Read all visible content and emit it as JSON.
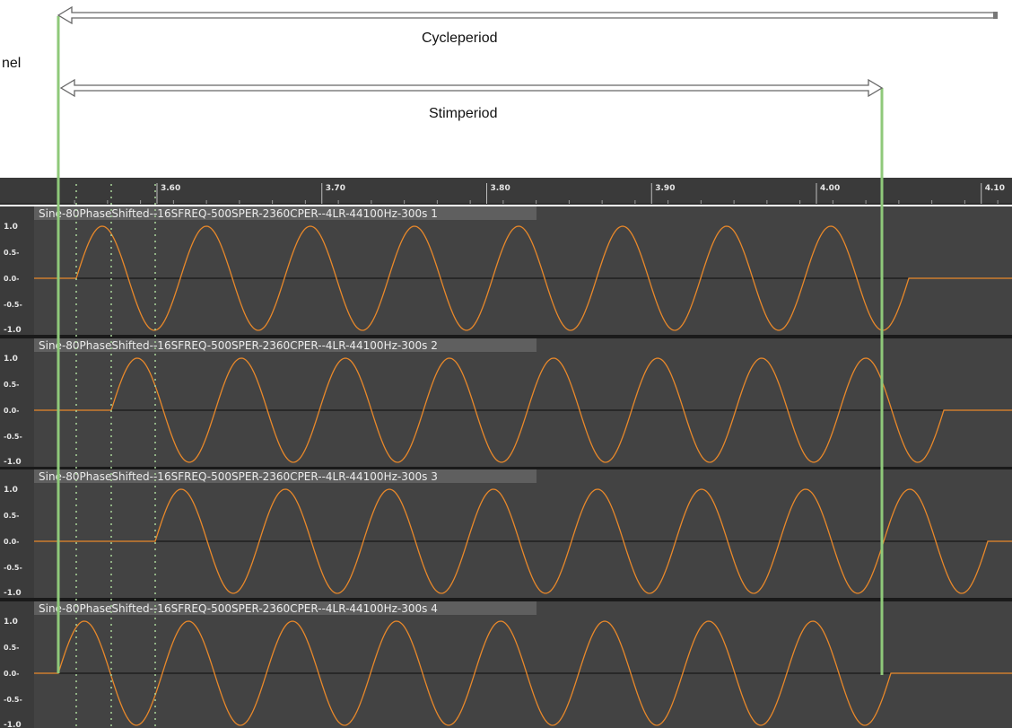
{
  "annotations": {
    "side_text": "nel",
    "cycle_label": "Cycleperiod",
    "stim_label": "Stimperiod"
  },
  "ruler": {
    "ticks": [
      "3.60",
      "3.70",
      "3.80",
      "3.90",
      "4.00",
      "4.10"
    ]
  },
  "tracks": [
    {
      "name": "Sine-80PhaseShifted--16SFREQ-500SPER-2360CPER--4LR-44100Hz-300s 1",
      "amp_labels": [
        "1.0",
        "0.5-",
        "0.0-",
        "-0.5-",
        "-1.0"
      ]
    },
    {
      "name": "Sine-80PhaseShifted--16SFREQ-500SPER-2360CPER--4LR-44100Hz-300s 2",
      "amp_labels": [
        "1.0",
        "0.5-",
        "0.0-",
        "-0.5-",
        "-1.0"
      ]
    },
    {
      "name": "Sine-80PhaseShifted--16SFREQ-500SPER-2360CPER--4LR-44100Hz-300s 3",
      "amp_labels": [
        "1.0",
        "0.5-",
        "0.0-",
        "-0.5-",
        "-1.0"
      ]
    },
    {
      "name": "Sine-80PhaseShifted--16SFREQ-500SPER-2360CPER--4LR-44100Hz-300s 4",
      "amp_labels": [
        "1.0",
        "0.5-",
        "0.0-",
        "-0.5-",
        "-1.0"
      ]
    }
  ],
  "colors": {
    "waveform": "#e8882a",
    "track_bg": "#434343",
    "track_header": "#5f5f5f",
    "ruler_bg": "#3a3a3a",
    "green_marker": "#8fc97a",
    "dotted_marker": "#a9d49a"
  }
}
